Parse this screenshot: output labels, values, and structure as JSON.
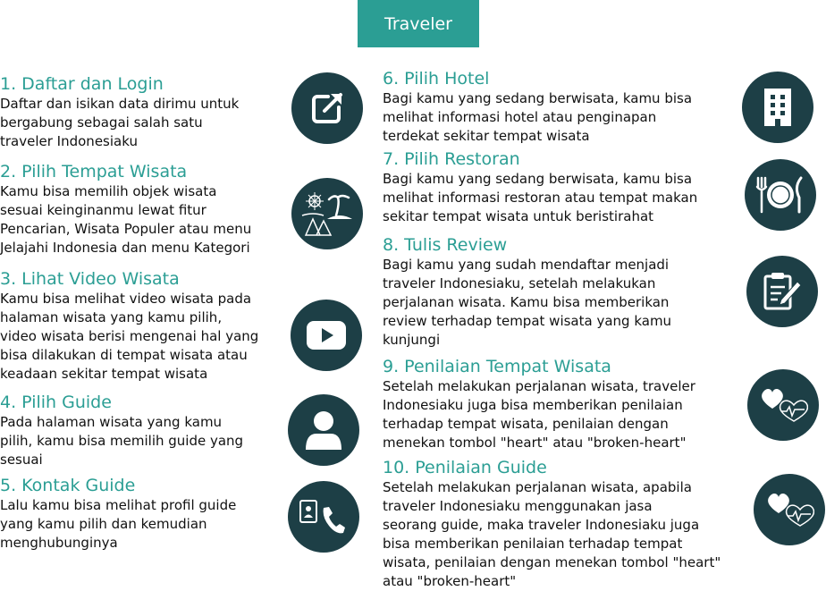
{
  "header": {
    "title": "Traveler"
  },
  "colors": {
    "accent": "#2b9e94",
    "icon_bg": "#1d3f46",
    "text": "#111111"
  },
  "steps": [
    {
      "title": "1. Daftar dan Login",
      "icon": "external-link-icon",
      "lines": [
        "Daftar dan isikan data dirimu untuk",
        "bergabung sebagai salah satu",
        "traveler Indonesiaku"
      ]
    },
    {
      "title": "2. Pilih Tempat Wisata",
      "icon": "landscape-icon",
      "lines": [
        "Kamu bisa memilih objek wisata",
        "sesuai keinginanmu lewat fitur",
        "Pencarian, Wisata Populer atau menu",
        "Jelajahi Indonesia dan menu Kategori"
      ]
    },
    {
      "title": "3. Lihat Video Wisata",
      "icon": "video-play-icon",
      "lines": [
        "Kamu bisa melihat video wisata pada",
        "halaman wisata yang kamu pilih,",
        "video wisata berisi mengenai hal yang",
        "bisa dilakukan di tempat wisata atau",
        "keadaan sekitar tempat wisata"
      ]
    },
    {
      "title": "4. Pilih Guide",
      "icon": "user-icon",
      "lines": [
        "Pada halaman wisata yang kamu",
        "pilih, kamu bisa memilih guide yang",
        "sesuai"
      ]
    },
    {
      "title": "5. Kontak Guide",
      "icon": "phone-contact-icon",
      "lines": [
        "Lalu kamu bisa melihat profil guide",
        "yang kamu pilih dan kemudian",
        "menghubunginya"
      ]
    },
    {
      "title": "6. Pilih Hotel",
      "icon": "hotel-building-icon",
      "lines": [
        "Bagi kamu yang sedang berwisata,  kamu bisa",
        "melihat informasi hotel atau penginapan",
        "terdekat sekitar tempat wisata"
      ]
    },
    {
      "title": "7. Pilih Restoran",
      "icon": "restaurant-icon",
      "lines": [
        "Bagi kamu yang sedang berwisata, kamu bisa",
        "melihat informasi restoran atau tempat makan",
        "sekitar tempat wisata untuk beristirahat"
      ]
    },
    {
      "title": "8. Tulis Review",
      "icon": "clipboard-pen-icon",
      "lines": [
        "Bagi kamu yang sudah mendaftar menjadi",
        "traveler Indonesiaku, setelah melakukan",
        "perjalanan wisata. Kamu bisa memberikan",
        "review terhadap tempat wisata yang kamu",
        "kunjungi"
      ]
    },
    {
      "title": "9. Penilaian Tempat Wisata",
      "icon": "heart-rate-icon",
      "lines": [
        "Setelah melakukan perjalanan wisata, traveler",
        "Indonesiaku juga bisa memberikan penilaian",
        "terhadap tempat wisata, penilaian dengan",
        "menekan tombol \"heart\" atau \"broken-heart\""
      ]
    },
    {
      "title": "10. Penilaian Guide",
      "icon": "heart-rate-icon",
      "lines": [
        "Setelah melakukan perjalanan wisata, apabila",
        "traveler Indonesiaku menggunakan jasa",
        "seorang guide, maka traveler Indonesiaku juga",
        "bisa memberikan penilaian terhadap tempat",
        "wisata, penilaian dengan menekan tombol \"heart\"",
        "atau \"broken-heart\""
      ]
    }
  ]
}
